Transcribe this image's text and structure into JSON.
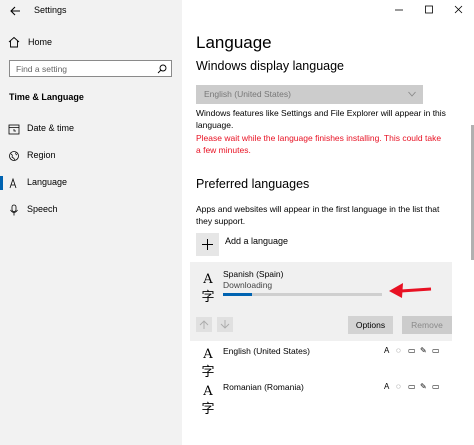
{
  "window": {
    "title": "Settings",
    "controls": [
      "minimize-icon",
      "maximize-icon",
      "close-icon"
    ]
  },
  "sidebar": {
    "home_label": "Home",
    "search_placeholder": "Find a setting",
    "section_title": "Time & Language",
    "items": [
      {
        "label": "Date & time",
        "icon": "clock-icon",
        "active": false
      },
      {
        "label": "Region",
        "icon": "globe-icon",
        "active": false
      },
      {
        "label": "Language",
        "icon": "language-icon",
        "active": true
      },
      {
        "label": "Speech",
        "icon": "microphone-icon",
        "active": false
      }
    ]
  },
  "main": {
    "title": "Language",
    "display_language": {
      "heading": "Windows display language",
      "selected": "English (United States)",
      "description": "Windows features like Settings and File Explorer will appear in this language.",
      "warning": "Please wait while the language finishes installing. This could take a few minutes."
    },
    "preferred": {
      "heading": "Preferred languages",
      "description": "Apps and websites will appear in the first language in the list that they support.",
      "add_label": "Add a language",
      "languages": [
        {
          "name": "Spanish (Spain)",
          "status": "Downloading",
          "progress": 0.18
        },
        {
          "name": "English (United States)"
        },
        {
          "name": "Romanian (Romania)"
        }
      ],
      "options_label": "Options",
      "remove_label": "Remove"
    }
  },
  "colors": {
    "accent": "#0063b1",
    "warning": "#e81123",
    "annotation_arrow": "#e81123"
  }
}
